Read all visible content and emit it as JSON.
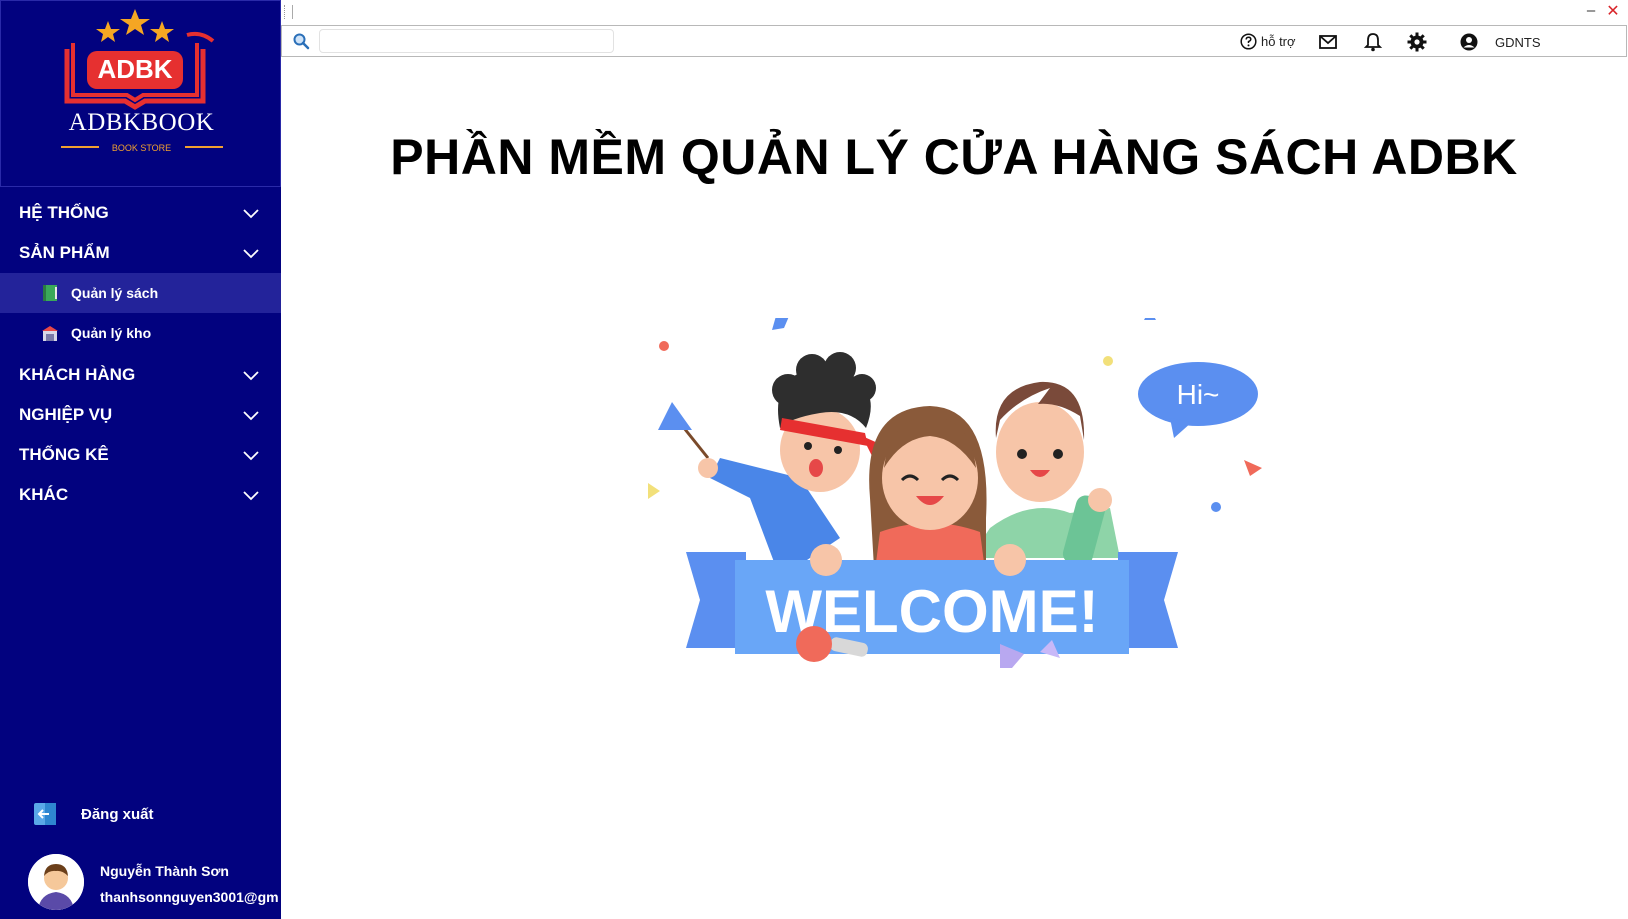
{
  "sidebar": {
    "logo": {
      "badge_text": "ADBK",
      "wordmark": "ADBKBOOK",
      "tagline": "BOOK STORE"
    },
    "menu": [
      {
        "label": "HỆ THỐNG"
      },
      {
        "label": "SẢN PHẨM"
      },
      {
        "label": "KHÁCH HÀNG"
      },
      {
        "label": "NGHIỆP VỤ"
      },
      {
        "label": "THỐNG KÊ"
      },
      {
        "label": "KHÁC"
      }
    ],
    "submenu": [
      {
        "label": "Quản lý sách",
        "icon": "book-icon",
        "active": true
      },
      {
        "label": "Quản lý kho",
        "icon": "warehouse-icon",
        "active": false
      }
    ],
    "logout_label": "Đăng xuất",
    "user": {
      "name": "Nguyễn Thành Sơn",
      "email": "thanhsonnguyen3001@gm"
    }
  },
  "toolbar": {
    "search_placeholder": "",
    "help_label": "hỗ trợ",
    "user_label": "GDNTS"
  },
  "window": {
    "minimize_label": "–",
    "close_label": "✕"
  },
  "main": {
    "title": "PHẦN MỀM QUẢN LÝ CỬA HÀNG SÁCH ADBK",
    "illustration": {
      "bubble_text": "Hi~",
      "banner_text": "WELCOME!"
    }
  },
  "colors": {
    "sidebar_bg": "#02027f",
    "sidebar_active": "#23239a",
    "accent_blue": "#5b9bf3",
    "close_red": "#d9252a"
  }
}
